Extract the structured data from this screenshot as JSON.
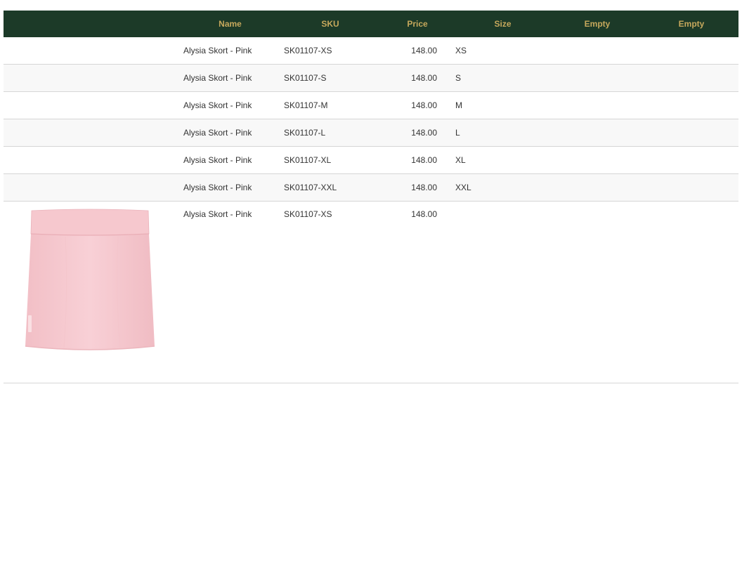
{
  "table": {
    "columns": [
      "",
      "Name",
      "SKU",
      "Price",
      "Size",
      "Empty",
      "Empty"
    ],
    "rows": [
      {
        "name": "Alysia Skort - Pink",
        "sku": "SK01107-XS",
        "price": "148.00",
        "size": "XS"
      },
      {
        "name": "Alysia Skort - Pink",
        "sku": "SK01107-S",
        "price": "148.00",
        "size": "S"
      },
      {
        "name": "Alysia Skort - Pink",
        "sku": "SK01107-M",
        "price": "148.00",
        "size": "M"
      },
      {
        "name": "Alysia Skort - Pink",
        "sku": "SK01107-L",
        "price": "148.00",
        "size": "L"
      },
      {
        "name": "Alysia Skort - Pink",
        "sku": "SK01107-XL",
        "price": "148.00",
        "size": "XL"
      },
      {
        "name": "Alysia Skort - Pink",
        "sku": "SK01107-XXL",
        "price": "148.00",
        "size": "XXL"
      }
    ],
    "image_row": {
      "name": "Alysia Skort - Pink",
      "sku": "SK01107-XS",
      "price": "148.00",
      "size": ""
    }
  },
  "colors": {
    "header_bg": "#1c3a28",
    "header_text": "#c6a85c",
    "product_pink": "#f6c9cf"
  },
  "icons": {
    "product_image": "pink-skort-image"
  }
}
